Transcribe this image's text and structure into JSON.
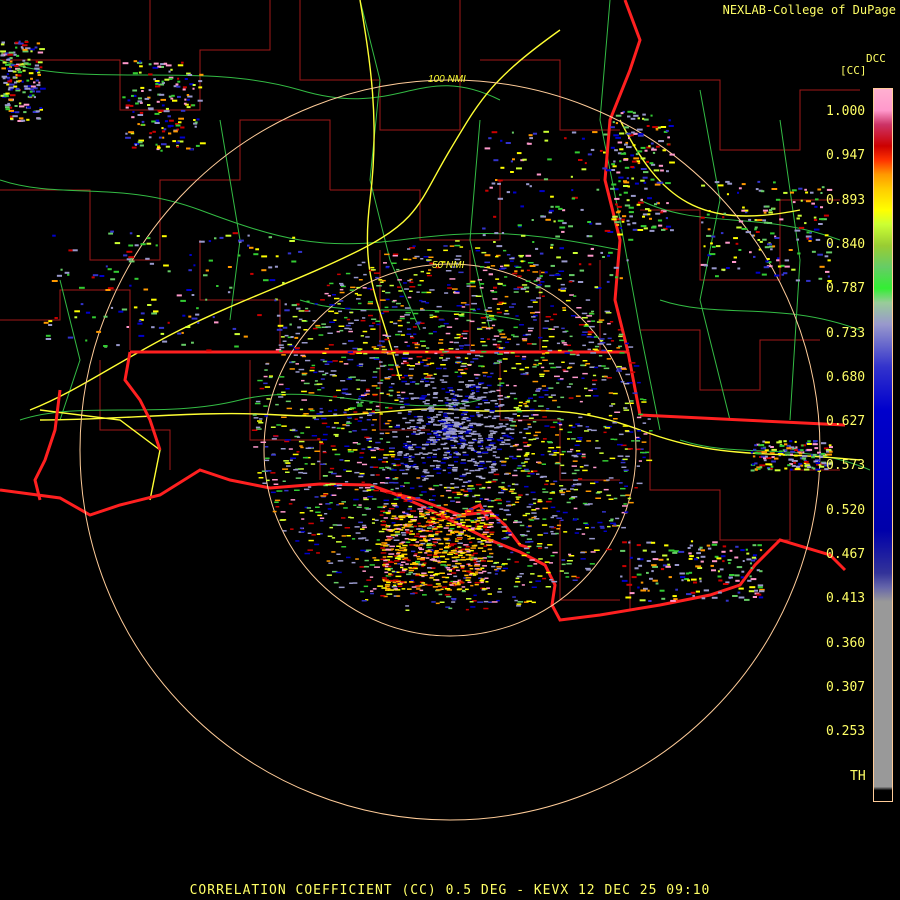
{
  "credit": "NEXLAB-College of DuPage",
  "product_code": "DCC",
  "units": "[CC]",
  "range_rings": [
    {
      "label": "100 NMI"
    },
    {
      "label": "50 NMI"
    }
  ],
  "legend": {
    "ticks": [
      "1.000",
      "0.947",
      "0.893",
      "0.840",
      "0.787",
      "0.733",
      "0.680",
      "0.627",
      "0.573",
      "0.520",
      "0.467",
      "0.413",
      "0.360",
      "0.307",
      "0.253",
      "TH"
    ],
    "colors": {
      "top_pink": "#ff99cc",
      "red": "#cc0000",
      "orange": "#ff9900",
      "yellow": "#ffff00",
      "green": "#33cc33",
      "lavender": "#9999cc",
      "blue": "#0000cc",
      "gray": "#999999"
    }
  },
  "colors": {
    "state_borders": "#ff2020",
    "county_lines": "#b01818",
    "highways": "#ffff33",
    "roads": "#33cc33",
    "rings": "#ffcc99"
  },
  "footer": "CORRELATION COEFFICIENT (CC) 0.5 DEG - KEVX 12 DEC 25 09:10"
}
